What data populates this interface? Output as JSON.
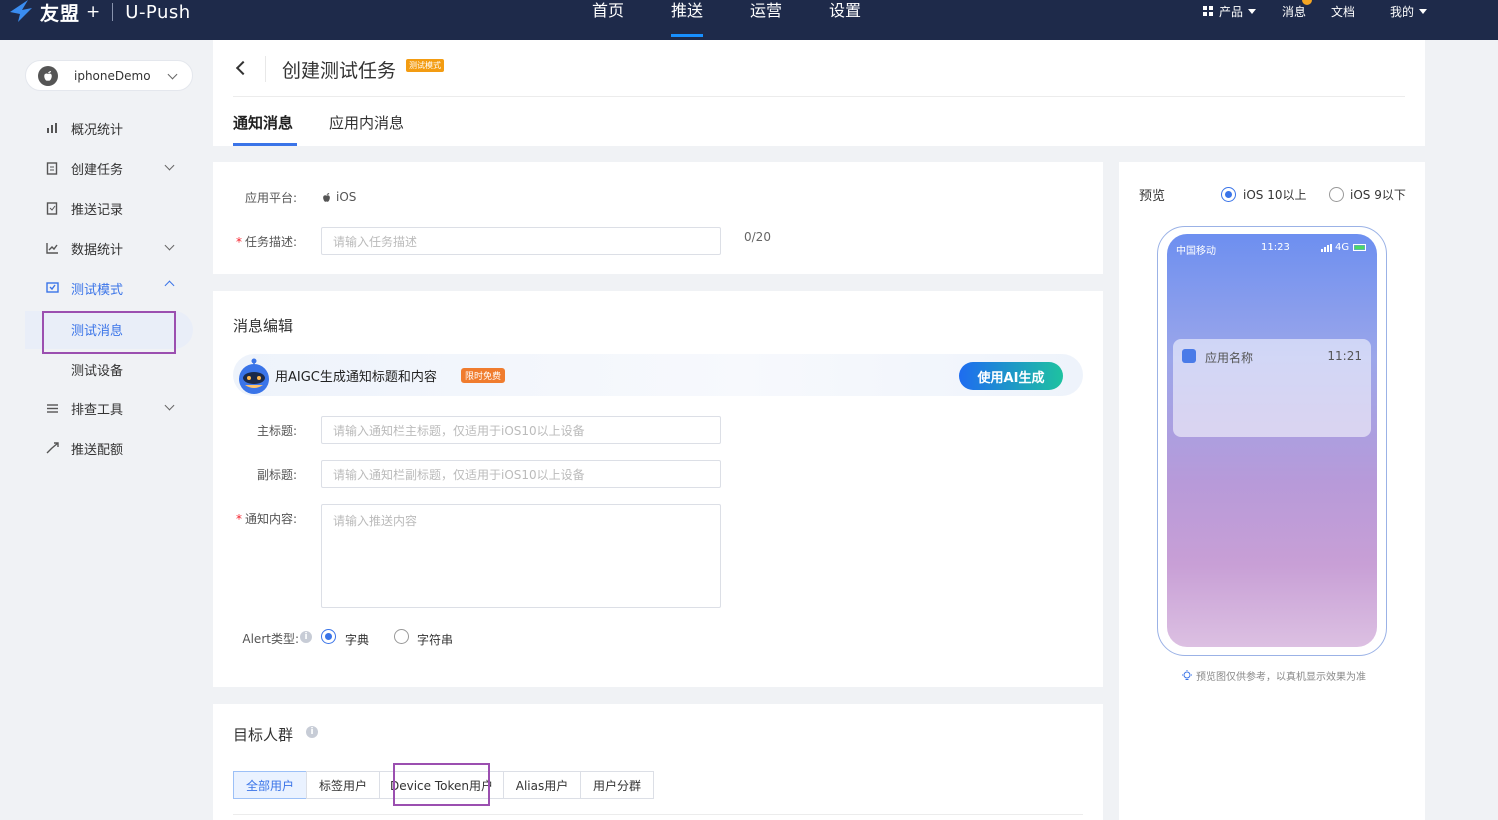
{
  "brand": {
    "name": "友盟",
    "plus": "+",
    "product": "U-Push"
  },
  "nav": {
    "items": [
      {
        "label": "首页",
        "active": false
      },
      {
        "label": "推送",
        "active": true
      },
      {
        "label": "运营",
        "active": false
      },
      {
        "label": "设置",
        "active": false
      }
    ],
    "products_label": "产品",
    "messages_label": "消息",
    "docs_label": "文档",
    "mine_label": "我的"
  },
  "sidebar": {
    "app_name": "iphoneDemo",
    "items": [
      {
        "label": "概况统计",
        "icon": "chart-bar-icon"
      },
      {
        "label": "创建任务",
        "icon": "task-icon"
      },
      {
        "label": "推送记录",
        "icon": "record-icon"
      },
      {
        "label": "数据统计",
        "icon": "line-chart-icon"
      },
      {
        "label": "测试模式",
        "icon": "test-icon"
      },
      {
        "label": "测试消息"
      },
      {
        "label": "测试设备"
      },
      {
        "label": "排查工具",
        "icon": "list-icon"
      },
      {
        "label": "推送配额",
        "icon": "quota-icon"
      }
    ]
  },
  "header": {
    "title": "创建测试任务",
    "mode_tag": "测试模式",
    "tabs": [
      "通知消息",
      "应用内消息"
    ]
  },
  "basic": {
    "platform_label": "应用平台:",
    "platform_value": "iOS",
    "desc_label": "任务描述:",
    "desc_placeholder": "请输入任务描述",
    "desc_counter": "0/20"
  },
  "editor": {
    "title": "消息编辑",
    "ai_text": "用AIGC生成通知标题和内容",
    "ai_tag": "限时免费",
    "ai_button": "使用AI生成",
    "title_label": "主标题:",
    "title_placeholder": "请输入通知栏主标题，仅适用于iOS10以上设备",
    "subtitle_label": "副标题:",
    "subtitle_placeholder": "请输入通知栏副标题，仅适用于iOS10以上设备",
    "content_label": "通知内容:",
    "content_placeholder": "请输入推送内容",
    "alert_label": "Alert类型:",
    "alert_options": [
      "字典",
      "字符串"
    ],
    "alert_selected": "字典"
  },
  "target": {
    "title": "目标人群",
    "segments": [
      "全部用户",
      "标签用户",
      "Device Token用户",
      "Alias用户",
      "用户分群"
    ],
    "selected": "全部用户"
  },
  "preview": {
    "title": "预览",
    "options": [
      "iOS 10以上",
      "iOS 9以下"
    ],
    "selected": "iOS 10以上",
    "carrier": "中国移动",
    "time": "11:23",
    "network": "4G",
    "notif_app": "应用名称",
    "notif_time": "11:21",
    "note": "预览图仅供参考，以真机显示效果为准"
  },
  "colors": {
    "topbar": "#1e2a4a",
    "accent": "#3a74e8",
    "highlight_box": "#9b4fb0"
  }
}
